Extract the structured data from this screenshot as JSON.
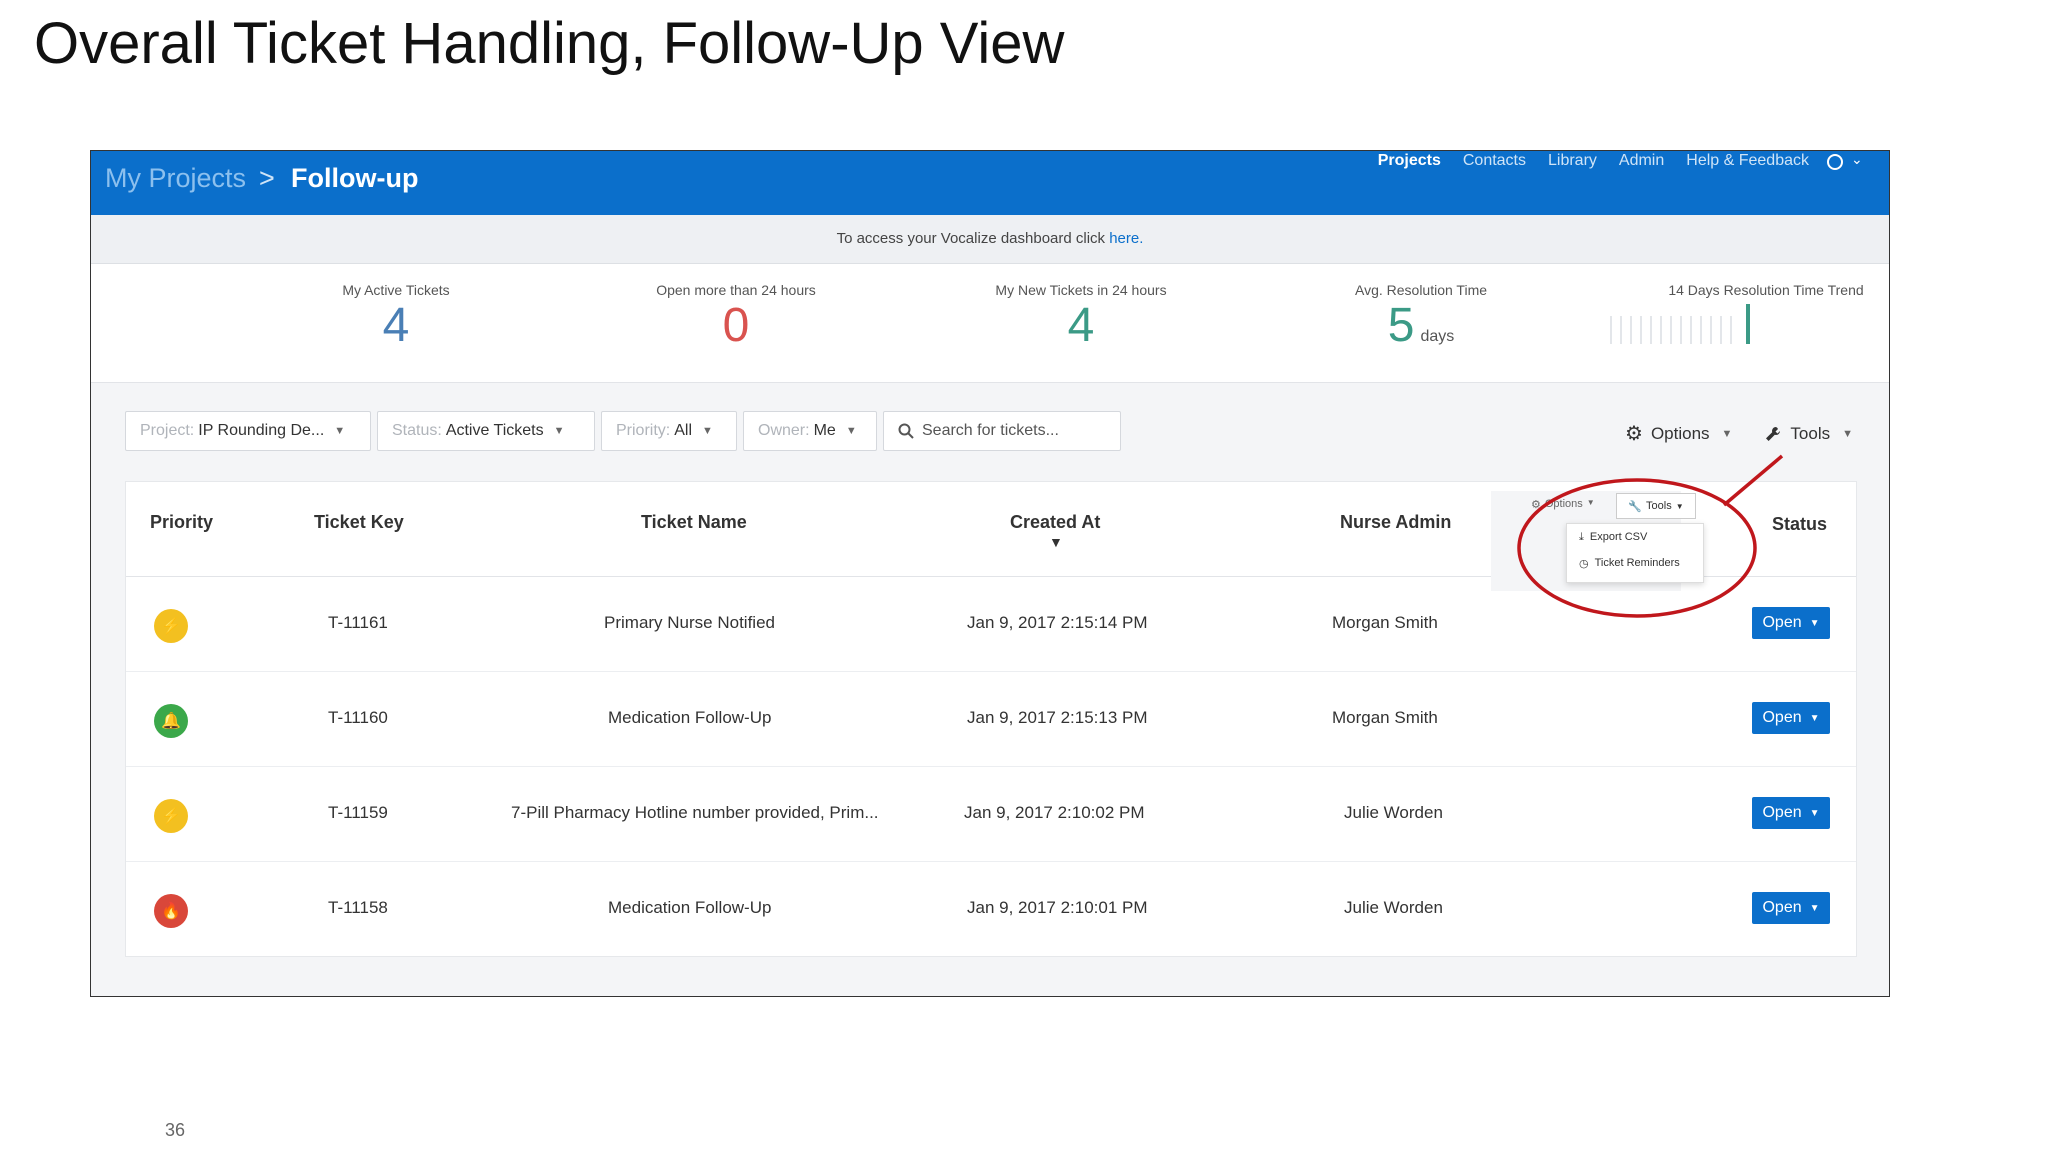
{
  "slide": {
    "title": "Overall Ticket Handling, Follow-Up View",
    "number": "36"
  },
  "header": {
    "breadcrumb_root": "My Projects",
    "breadcrumb_sep": ">",
    "breadcrumb_current": "Follow-up",
    "nav": [
      "Projects",
      "Contacts",
      "Library",
      "Admin",
      "Help & Feedback"
    ],
    "account_chevron": "⌄"
  },
  "banner": {
    "text": "To access your Vocalize dashboard click ",
    "link": "here."
  },
  "stats": [
    {
      "label": "My Active Tickets",
      "value": "4",
      "color": "#4a7fb5"
    },
    {
      "label": "Open more than 24 hours",
      "value": "0",
      "color": "#d9534f"
    },
    {
      "label": "My New Tickets in 24 hours",
      "value": "4",
      "color": "#3b9a86"
    },
    {
      "label": "Avg. Resolution Time",
      "value": "5",
      "unit": "days",
      "color": "#3b9a86"
    },
    {
      "label": "14 Days Resolution Time Trend"
    }
  ],
  "filters": {
    "project": {
      "key": "Project:",
      "value": "IP Rounding De..."
    },
    "status": {
      "key": "Status:",
      "value": "Active Tickets"
    },
    "priority": {
      "key": "Priority:",
      "value": "All"
    },
    "owner": {
      "key": "Owner:",
      "value": "Me"
    },
    "search_placeholder": "Search for tickets..."
  },
  "toolbar": {
    "options": "Options",
    "tools": "Tools"
  },
  "table": {
    "headers": {
      "priority": "Priority",
      "key": "Ticket Key",
      "name": "Ticket Name",
      "created": "Created At",
      "nurse": "Nurse Admin",
      "status": "Status"
    },
    "sort_indicator": "▼",
    "rows": [
      {
        "priority": "yellow",
        "icon": "lightning-icon",
        "glyph": "⚡",
        "color": "#f3c020",
        "key": "T-11161",
        "name": "Primary Nurse Notified",
        "created": "Jan 9, 2017 2:15:14 PM",
        "nurse": "Morgan Smith",
        "status": "Open"
      },
      {
        "priority": "green",
        "icon": "bell-icon",
        "glyph": "🔔",
        "color": "#3ba84a",
        "key": "T-11160",
        "name": "Medication Follow-Up",
        "created": "Jan 9, 2017 2:15:13 PM",
        "nurse": "Morgan Smith",
        "status": "Open"
      },
      {
        "priority": "yellow",
        "icon": "lightning-icon",
        "glyph": "⚡",
        "color": "#f3c020",
        "key": "T-11159",
        "name": "7-Pill Pharmacy Hotline number provided, Prim...",
        "created": "Jan 9, 2017 2:10:02 PM",
        "nurse": "Julie Worden",
        "status": "Open"
      },
      {
        "priority": "red",
        "icon": "flame-icon",
        "glyph": "🔥",
        "color": "#d9473a",
        "key": "T-11158",
        "name": "Medication Follow-Up",
        "created": "Jan 9, 2017 2:10:01 PM",
        "nurse": "Julie Worden",
        "status": "Open"
      }
    ]
  },
  "inset": {
    "options": "Options",
    "tools": "Tools",
    "menu": [
      "Export CSV",
      "Ticket Reminders"
    ]
  },
  "colors": {
    "brand": "#0b6fcb",
    "annotation": "#c0171c"
  }
}
